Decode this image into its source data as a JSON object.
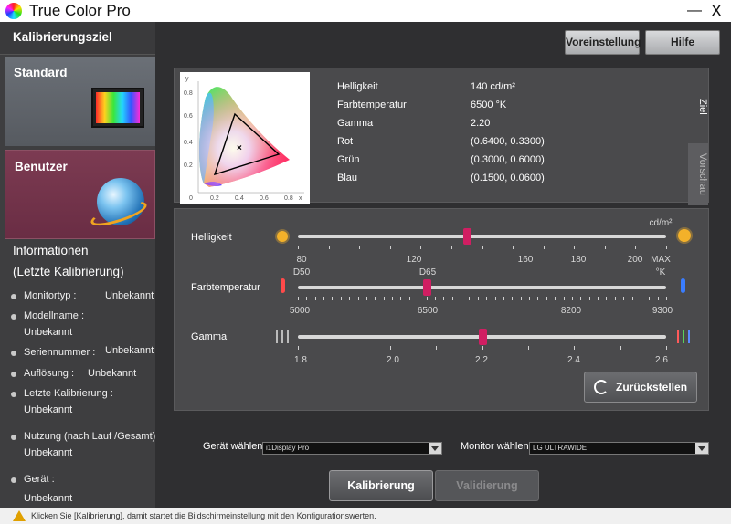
{
  "window": {
    "title": "True Color Pro",
    "minimize": "—",
    "close": "X"
  },
  "sidebar": {
    "header": "Kalibrierungsziel",
    "tiles": [
      {
        "label": "Standard",
        "icon": "monitor-color-icon"
      },
      {
        "label": "Benutzer",
        "icon": "globe-icon"
      }
    ],
    "info_title": "Informationen",
    "info_subtitle": "(Letzte Kalibrierung)",
    "info": [
      {
        "label": "Monitortyp :",
        "value": "Unbekannt"
      },
      {
        "label": "Modellname :",
        "value": "Unbekannt"
      },
      {
        "label": "Seriennummer :",
        "value": "Unbekannt"
      },
      {
        "label": "Auflösung :",
        "value": "Unbekannt"
      },
      {
        "label": "Letzte Kalibrierung :",
        "value": "Unbekannt"
      },
      {
        "label": "Nutzung (nach Lauf /Gesamt) :",
        "value": "Unbekannt"
      },
      {
        "label": "Gerät :",
        "value": "Unbekannt"
      }
    ]
  },
  "toolbar": {
    "preset_label": "Voreinstellung",
    "help_label": "Hilfe"
  },
  "target": {
    "cie": {
      "y_axis": "y",
      "x_axis": "x",
      "y_ticks": [
        "0.8",
        "0.6",
        "0.4",
        "0.2"
      ],
      "x_ticks": [
        "0",
        "0.2",
        "0.4",
        "0.6",
        "0.8"
      ]
    },
    "params": [
      {
        "label": "Helligkeit",
        "value": "140 cd/m²"
      },
      {
        "label": "Farbtemperatur",
        "value": "6500 °K"
      },
      {
        "label": "Gamma",
        "value": "2.20"
      },
      {
        "label": "Rot",
        "value": "(0.6400, 0.3300)"
      },
      {
        "label": "Grün",
        "value": "(0.3000, 0.6000)"
      },
      {
        "label": "Blau",
        "value": "(0.1500, 0.0600)"
      }
    ],
    "tab_target": "Ziel",
    "tab_preview": "Vorschau"
  },
  "sliders": {
    "brightness": {
      "label": "Helligkeit",
      "unit": "cd/m²",
      "ticks": [
        "80",
        "120",
        "160",
        "180",
        "200",
        "MAX"
      ],
      "value_fraction": 0.46
    },
    "temperature": {
      "label": "Farbtemperatur",
      "unit": "°K",
      "top_labels": [
        "D50",
        "D65"
      ],
      "ticks": [
        "5000",
        "6500",
        "8200",
        "9300"
      ],
      "value_fraction": 0.35
    },
    "gamma": {
      "label": "Gamma",
      "ticks": [
        "1.8",
        "2.0",
        "2.2",
        "2.4",
        "2.6"
      ],
      "value_fraction": 0.5
    },
    "reset_label": "Zurückstellen"
  },
  "device": {
    "label": "Gerät wählen",
    "value": "i1Display Pro"
  },
  "monitor": {
    "label": "Monitor wählen",
    "value": "LG ULTRAWIDE"
  },
  "actions": {
    "calibrate_label": "Kalibrierung",
    "validate_label": "Validierung"
  },
  "status": {
    "text": "Klicken Sie [Kalibrierung], damit startet die Bildschirmeinstellung mit den Konfigurationswerten."
  }
}
